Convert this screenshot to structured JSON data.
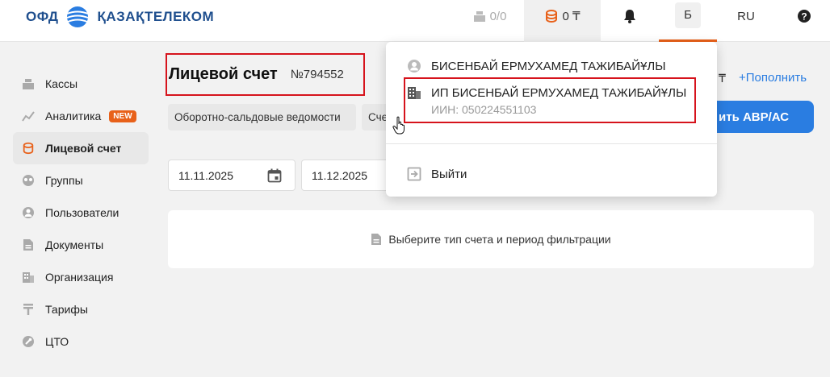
{
  "header": {
    "logo_ofd": "ОФД",
    "logo_name": "ҚАЗАҚТЕЛЕКОМ",
    "kassy_count": "0/0",
    "balance": "0 ₸",
    "user_initial": "Б",
    "language": "RU"
  },
  "sidebar": {
    "items": [
      {
        "label": "Кассы",
        "icon": "cash-register-icon"
      },
      {
        "label": "Аналитика",
        "icon": "chart-icon",
        "badge": "NEW"
      },
      {
        "label": "Лицевой счет",
        "icon": "coins-icon",
        "active": true
      },
      {
        "label": "Группы",
        "icon": "groups-icon"
      },
      {
        "label": "Пользователи",
        "icon": "user-icon"
      },
      {
        "label": "Документы",
        "icon": "document-icon"
      },
      {
        "label": "Организация",
        "icon": "building-icon"
      },
      {
        "label": "Тарифы",
        "icon": "tariff-icon"
      },
      {
        "label": "ЦТО",
        "icon": "wrench-icon"
      }
    ]
  },
  "main": {
    "title": "Лицевой счет",
    "account_number": "№794552",
    "chips": [
      "Оборотно-сальдовые ведомости",
      "Сче"
    ],
    "currency_partial": "₸",
    "topup_link": "+Пополнить",
    "avr_button": "ить АВР/АС",
    "date_from": "11.11.2025",
    "date_to": "11.12.2025",
    "empty_message": "Выберите тип счета и период фильтрации"
  },
  "dropdown": {
    "person_name": "БИСЕНБАЙ ЕРМУХАМЕД ТАЖИБАЙҰЛЫ",
    "org_name": "ИП БИСЕНБАЙ ЕРМУХАМЕД ТАЖИБАЙҰЛЫ",
    "org_iin": "ИИН: 050224551103",
    "logout": "Выйти"
  },
  "colors": {
    "accent_orange": "#e8611a",
    "primary_blue": "#2a7de1",
    "highlight_red": "#d6131c",
    "brand_navy": "#1f4f8e"
  }
}
